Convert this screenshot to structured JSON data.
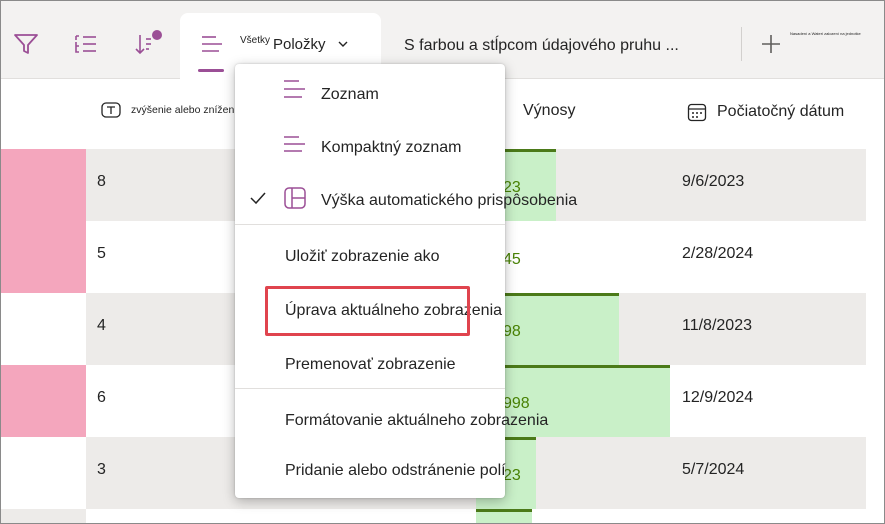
{
  "toolbar": {
    "view_small_label": "Všetky",
    "view_label": "Položky",
    "tab2_label": "S farbou a stĺpcom údajového pruhu ...",
    "tab3_label": "Nasadení a Wateri zalození na jednotke"
  },
  "columns": {
    "col1_label": "zvýšenie alebo zníženie počtu desatinných miest vo formátovaní čísel",
    "col2_label": "Výnosy",
    "col3_label": "Počiatočný dátum"
  },
  "rows": [
    {
      "num": "8",
      "revenue": "23",
      "date": "9/6/2023"
    },
    {
      "num": "5",
      "revenue": "45",
      "date": "2/28/2024"
    },
    {
      "num": "4",
      "revenue": "98",
      "date": "11/8/2023"
    },
    {
      "num": "6",
      "revenue": "998",
      "date": "12/9/2024"
    },
    {
      "num": "3",
      "revenue": "23",
      "date": "5/7/2024"
    }
  ],
  "menu": {
    "items": [
      {
        "label": "Zoznam"
      },
      {
        "label": "Kompaktný zoznam"
      },
      {
        "label": "Výška automatického prispôsobenia"
      },
      {
        "label": "Uložiť zobrazenie ako"
      },
      {
        "label": "Úprava aktuálneho zobrazenia"
      },
      {
        "label": "Premenovať zobrazenie"
      },
      {
        "label": "Formátovanie aktuálneho zobrazenia"
      },
      {
        "label": "Pridanie alebo odstránenie polí"
      }
    ]
  },
  "colors": {
    "accent": "#9b4f96",
    "pink_cell": "#f4a6bd",
    "bar_fill": "#c9f0c8",
    "bar_border": "#4b7a19",
    "highlight": "#e0444e"
  }
}
